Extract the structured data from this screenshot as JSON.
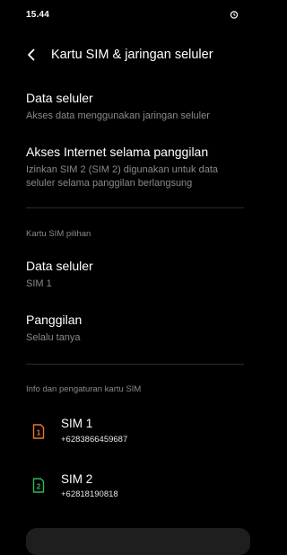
{
  "status_bar": {
    "time": "15.44",
    "right_icon": "alarm-clock-icon"
  },
  "header": {
    "back_icon": "back-arrow-icon",
    "title": "Kartu SIM & jaringan seluler"
  },
  "items": {
    "mobile_data": {
      "title": "Data seluler",
      "subtitle": "Akses data menggunakan jaringan seluler"
    },
    "internet_during_calls": {
      "title": "Akses Internet selama panggilan",
      "subtitle_line1": "Izinkan SIM 2 (SIM 2) digunakan untuk data",
      "subtitle_line2": "seluler selama panggilan berlangsung"
    }
  },
  "preferred_sim": {
    "section_label": "Kartu SIM pilihan",
    "data": {
      "title": "Data seluler",
      "value": "SIM 1"
    },
    "calls": {
      "title": "Panggilan",
      "value": "Selalu tanya"
    }
  },
  "sim_info": {
    "section_label": "Info dan pengaturan kartu SIM",
    "sims": [
      {
        "badge": "1",
        "name": "SIM 1",
        "number": "+6283866459687",
        "color": "#e8772e"
      },
      {
        "badge": "2",
        "name": "SIM 2",
        "number": "+62818190818",
        "color": "#2fb85a"
      }
    ]
  }
}
